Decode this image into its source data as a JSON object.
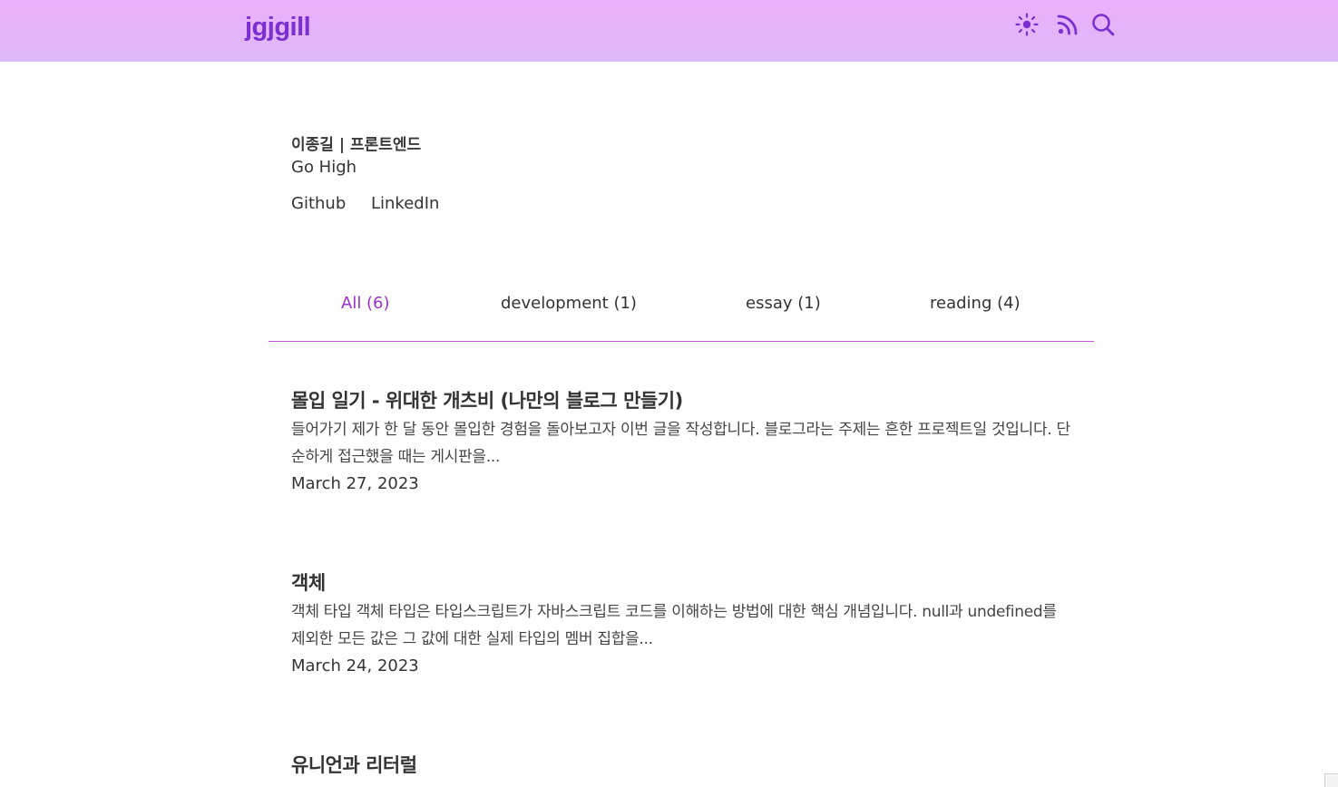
{
  "header": {
    "logo": "jgjgill",
    "icons": [
      "sun-icon",
      "rss-icon",
      "search-icon"
    ],
    "accent_color": "#7b2fd0"
  },
  "bio": {
    "name": "이종길 | 프론트엔드",
    "description": "Go High",
    "links": [
      "Github",
      "LinkedIn"
    ]
  },
  "tabs": [
    {
      "label": "All (6)",
      "active": true
    },
    {
      "label": "development (1)",
      "active": false
    },
    {
      "label": "essay (1)",
      "active": false
    },
    {
      "label": "reading (4)",
      "active": false
    }
  ],
  "posts": [
    {
      "title": "몰입 일기 - 위대한 개츠비 (나만의 블로그 만들기)",
      "excerpt": "들어가기 제가 한 달 동안 몰입한 경험을 돌아보고자 이번 글을 작성합니다. 블로그라는 주제는 흔한 프로젝트일 것입니다. 단순하게 접근했을 때는 게시판을...",
      "date": "March 27, 2023"
    },
    {
      "title": "객체",
      "excerpt": "객체 타입 객체 타입은 타입스크립트가 자바스크립트 코드를 이해하는 방법에 대한 핵심 개념입니다. null과 undefined를 제외한 모든 값은 그 값에 대한 실제 타입의 멤버 집합을...",
      "date": "March 24, 2023"
    },
    {
      "title": "유니언과 리터럴",
      "excerpt": "",
      "date": ""
    }
  ]
}
